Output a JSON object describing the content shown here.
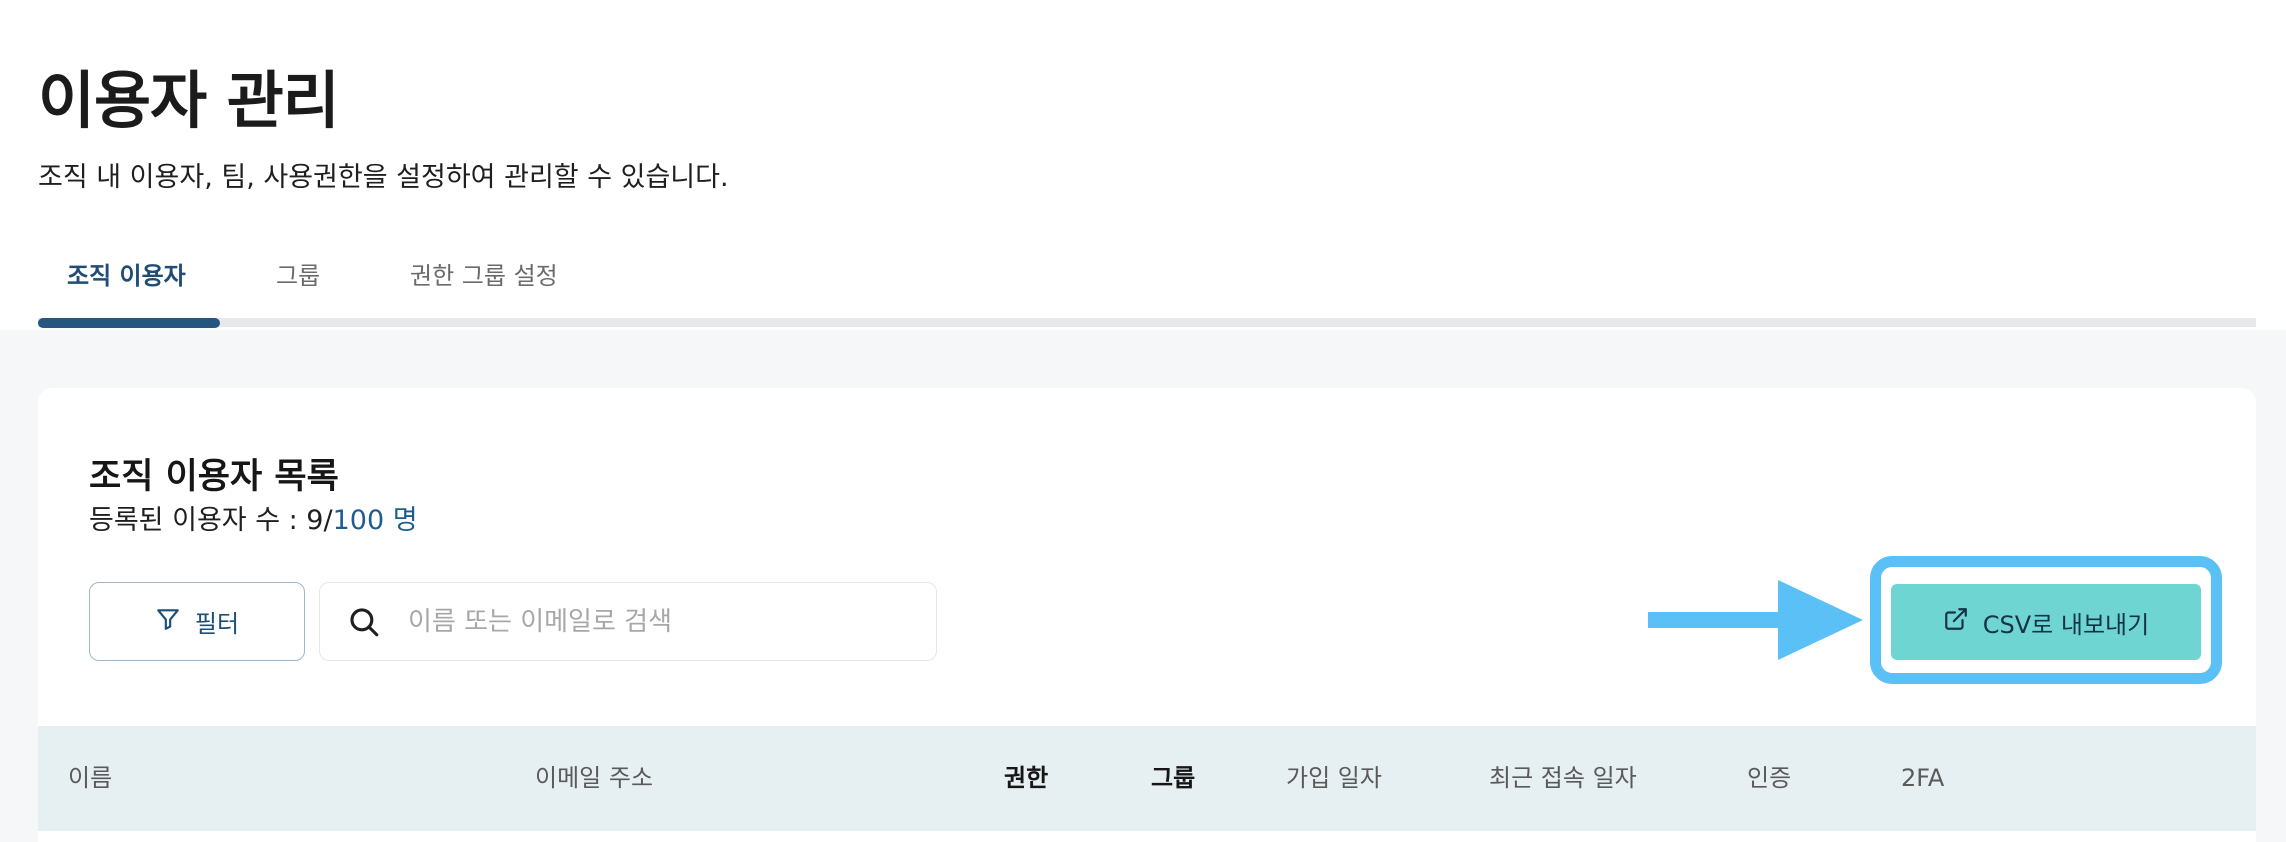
{
  "page": {
    "title": "이용자 관리",
    "description": "조직 내 이용자, 팀, 사용권한을 설정하여 관리할 수 있습니다."
  },
  "tabs": [
    {
      "label": "조직 이용자",
      "active": true
    },
    {
      "label": "그룹",
      "active": false
    },
    {
      "label": "권한 그룹 설정",
      "active": false
    }
  ],
  "card": {
    "title": "조직 이용자 목록",
    "count_prefix": "등록된 이용자 수 : 9/",
    "count_max": "100 명"
  },
  "toolbar": {
    "filter_label": "필터",
    "search_placeholder": "이름 또는 이메일로 검색",
    "search_value": "",
    "export_label": "CSV로 내보내기"
  },
  "table": {
    "columns": [
      "이름",
      "이메일 주소",
      "권한",
      "그룹",
      "가입 일자",
      "최근 접속 일자",
      "인증",
      "2FA"
    ]
  },
  "colors": {
    "accent": "#24567f",
    "export_button": "#6ed5d3",
    "annotation": "#5bc0f5",
    "table_header_bg": "#e6eff2"
  },
  "icons": [
    "filter-icon",
    "search-icon",
    "external-link-icon",
    "annotation-arrow"
  ]
}
